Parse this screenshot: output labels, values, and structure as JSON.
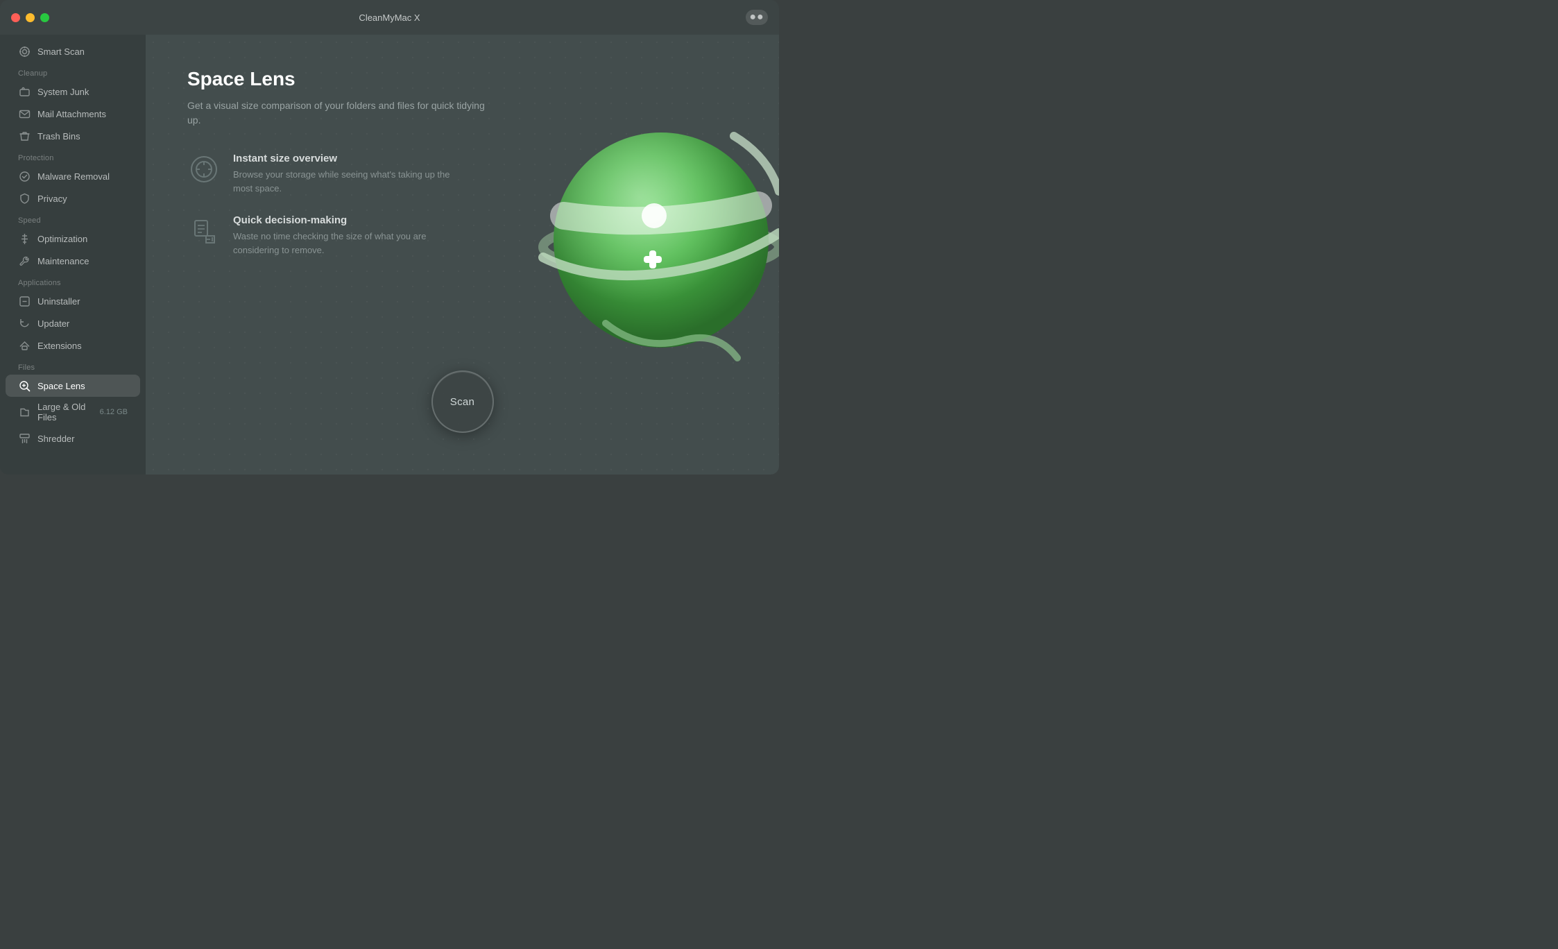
{
  "window": {
    "title": "CleanMyMac X"
  },
  "titlebar": {
    "more_icon": "●●"
  },
  "sidebar": {
    "smart_scan": "Smart Scan",
    "sections": [
      {
        "label": "Cleanup",
        "items": [
          {
            "id": "system-junk",
            "label": "System Junk",
            "icon": "system-junk-icon"
          },
          {
            "id": "mail-attachments",
            "label": "Mail Attachments",
            "icon": "mail-icon"
          },
          {
            "id": "trash-bins",
            "label": "Trash Bins",
            "icon": "trash-icon"
          }
        ]
      },
      {
        "label": "Protection",
        "items": [
          {
            "id": "malware-removal",
            "label": "Malware Removal",
            "icon": "malware-icon"
          },
          {
            "id": "privacy",
            "label": "Privacy",
            "icon": "privacy-icon"
          }
        ]
      },
      {
        "label": "Speed",
        "items": [
          {
            "id": "optimization",
            "label": "Optimization",
            "icon": "optimization-icon"
          },
          {
            "id": "maintenance",
            "label": "Maintenance",
            "icon": "maintenance-icon"
          }
        ]
      },
      {
        "label": "Applications",
        "items": [
          {
            "id": "uninstaller",
            "label": "Uninstaller",
            "icon": "uninstaller-icon"
          },
          {
            "id": "updater",
            "label": "Updater",
            "icon": "updater-icon"
          },
          {
            "id": "extensions",
            "label": "Extensions",
            "icon": "extensions-icon"
          }
        ]
      },
      {
        "label": "Files",
        "items": [
          {
            "id": "space-lens",
            "label": "Space Lens",
            "icon": "space-lens-icon",
            "active": true
          },
          {
            "id": "large-old-files",
            "label": "Large & Old Files",
            "icon": "files-icon",
            "badge": "6.12 GB"
          },
          {
            "id": "shredder",
            "label": "Shredder",
            "icon": "shredder-icon"
          }
        ]
      }
    ]
  },
  "content": {
    "title": "Space Lens",
    "subtitle": "Get a visual size comparison of your folders and files\nfor quick tidying up.",
    "features": [
      {
        "id": "instant-size",
        "title": "Instant size overview",
        "description": "Browse your storage while seeing what's taking up the most space."
      },
      {
        "id": "quick-decision",
        "title": "Quick decision-making",
        "description": "Waste no time checking the size of what you are considering to remove."
      }
    ],
    "scan_button": "Scan"
  }
}
